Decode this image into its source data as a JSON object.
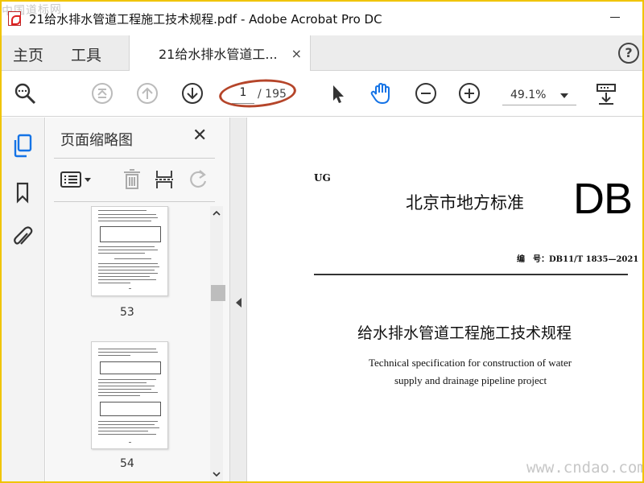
{
  "window": {
    "title": "21给水排水管道工程施工技术规程.pdf - Adobe Acrobat Pro DC",
    "watermark": "中国道标网"
  },
  "tabs": {
    "home": "主页",
    "tools": "工具",
    "document": "21给水排水管道工...",
    "close": "×",
    "help": "?"
  },
  "toolbar": {
    "page_current": "1",
    "page_total": "/ 195",
    "zoom": "49.1%"
  },
  "panel": {
    "title": "页面缩略图",
    "close": "✕",
    "thumbnails": [
      {
        "page": "53"
      },
      {
        "page": "54"
      }
    ]
  },
  "document": {
    "ug": "UG",
    "standard": "北京市地方标准",
    "db": "DB",
    "code": "编　号：DB11/T 1835—2021",
    "title_cn": "给水排水管道工程施工技术规程",
    "title_en_line1": "Technical specification for construction of water",
    "title_en_line2": "supply and drainage pipeline project"
  },
  "watermark_url": "www.cndao.com",
  "colors": {
    "border": "#f0c400",
    "annotation": "#b5452a",
    "acrobat_blue": "#1473e6"
  },
  "icons": [
    "search-icon",
    "first-page-icon",
    "prev-page-icon",
    "next-page-icon",
    "select-cursor-icon",
    "hand-tool-icon",
    "zoom-out-icon",
    "zoom-in-icon",
    "scroll-mode-icon",
    "page-thumbnails-icon",
    "bookmark-icon",
    "attachment-icon",
    "options-menu-icon",
    "trash-icon",
    "insert-page-icon",
    "rotate-icon"
  ]
}
